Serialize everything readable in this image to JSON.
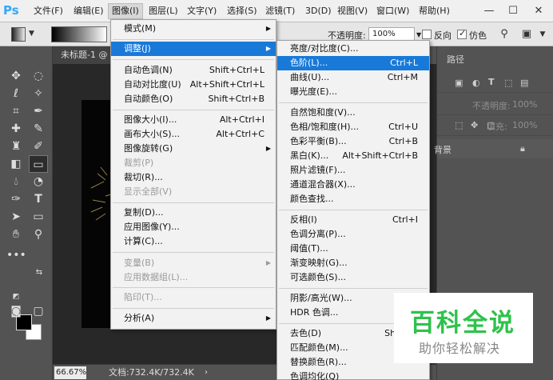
{
  "app": {
    "logo": "Ps"
  },
  "menubar": {
    "items": [
      "文件(F)",
      "编辑(E)",
      "图像(I)",
      "图层(L)",
      "文字(Y)",
      "选择(S)",
      "滤镜(T)",
      "3D(D)",
      "视图(V)",
      "窗口(W)",
      "帮助(H)"
    ],
    "window_controls": {
      "minimize": "—",
      "maximize": "☐",
      "close": "✕"
    }
  },
  "options_bar": {
    "opacity_label": "不透明度:",
    "opacity_value": "100%",
    "reverse_label": "反向",
    "dither_label": "仿色",
    "dither_checked": true
  },
  "document": {
    "tab_title": "未标题-1 @",
    "zoom": "66.67%",
    "doc_info": "文档:732.4K/732.4K",
    "status_arrow": "›"
  },
  "right_panel": {
    "paths_tab": "路径",
    "opacity_label": "不透明度:",
    "opacity_value": "100%",
    "fill_label": "填充:",
    "fill_value": "100%",
    "layer_name": "背景",
    "lock_icon": "lock-icon"
  },
  "image_menu": {
    "items": [
      {
        "label": "模式(M)",
        "shortcut": "",
        "submenu": true,
        "disabled": false
      },
      {
        "label": "调整(J)",
        "shortcut": "",
        "submenu": true,
        "disabled": false,
        "highlighted": true
      },
      {
        "label": "自动色调(N)",
        "shortcut": "Shift+Ctrl+L",
        "disabled": false
      },
      {
        "label": "自动对比度(U)",
        "shortcut": "Alt+Shift+Ctrl+L",
        "disabled": false
      },
      {
        "label": "自动颜色(O)",
        "shortcut": "Shift+Ctrl+B",
        "disabled": false
      },
      {
        "label": "图像大小(I)...",
        "shortcut": "Alt+Ctrl+I",
        "disabled": false
      },
      {
        "label": "画布大小(S)...",
        "shortcut": "Alt+Ctrl+C",
        "disabled": false
      },
      {
        "label": "图像旋转(G)",
        "shortcut": "",
        "submenu": true,
        "disabled": false
      },
      {
        "label": "裁剪(P)",
        "shortcut": "",
        "disabled": true
      },
      {
        "label": "裁切(R)...",
        "shortcut": "",
        "disabled": false
      },
      {
        "label": "显示全部(V)",
        "shortcut": "",
        "disabled": true
      },
      {
        "label": "复制(D)...",
        "shortcut": "",
        "disabled": false
      },
      {
        "label": "应用图像(Y)...",
        "shortcut": "",
        "disabled": false
      },
      {
        "label": "计算(C)...",
        "shortcut": "",
        "disabled": false
      },
      {
        "label": "变量(B)",
        "shortcut": "",
        "submenu": true,
        "disabled": true
      },
      {
        "label": "应用数据组(L)...",
        "shortcut": "",
        "disabled": true
      },
      {
        "label": "陷印(T)...",
        "shortcut": "",
        "disabled": true
      },
      {
        "label": "分析(A)",
        "shortcut": "",
        "submenu": true,
        "disabled": false
      }
    ]
  },
  "adjust_menu": {
    "items": [
      {
        "label": "亮度/对比度(C)...",
        "shortcut": ""
      },
      {
        "label": "色阶(L)...",
        "shortcut": "Ctrl+L",
        "highlighted": true
      },
      {
        "label": "曲线(U)...",
        "shortcut": "Ctrl+M"
      },
      {
        "label": "曝光度(E)...",
        "shortcut": ""
      },
      {
        "label": "自然饱和度(V)...",
        "shortcut": ""
      },
      {
        "label": "色相/饱和度(H)...",
        "shortcut": "Ctrl+U"
      },
      {
        "label": "色彩平衡(B)...",
        "shortcut": "Ctrl+B"
      },
      {
        "label": "黑白(K)...",
        "shortcut": "Alt+Shift+Ctrl+B"
      },
      {
        "label": "照片滤镜(F)...",
        "shortcut": ""
      },
      {
        "label": "通道混合器(X)...",
        "shortcut": ""
      },
      {
        "label": "颜色查找...",
        "shortcut": ""
      },
      {
        "label": "反相(I)",
        "shortcut": "Ctrl+I"
      },
      {
        "label": "色调分离(P)...",
        "shortcut": ""
      },
      {
        "label": "阈值(T)...",
        "shortcut": ""
      },
      {
        "label": "渐变映射(G)...",
        "shortcut": ""
      },
      {
        "label": "可选颜色(S)...",
        "shortcut": ""
      },
      {
        "label": "阴影/高光(W)...",
        "shortcut": ""
      },
      {
        "label": "HDR 色调...",
        "shortcut": ""
      },
      {
        "label": "去色(D)",
        "shortcut": "Shift+C"
      },
      {
        "label": "匹配颜色(M)...",
        "shortcut": ""
      },
      {
        "label": "替换颜色(R)...",
        "shortcut": ""
      },
      {
        "label": "色调均化(Q)",
        "shortcut": ""
      }
    ]
  },
  "watermark": {
    "title": "百科全说",
    "subtitle": "助你轻松解决"
  },
  "colors": {
    "highlight": "#1979d9",
    "watermark_green": "#2ec24a",
    "ps_blue": "#31a8ff"
  }
}
